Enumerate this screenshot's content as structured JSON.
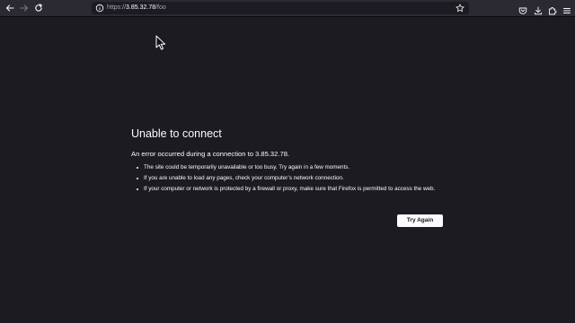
{
  "browser": {
    "url_scheme": "https://",
    "url_host": "3.85.32.78",
    "url_path": "/foo"
  },
  "icons": {
    "back": "back-arrow-icon",
    "forward": "forward-arrow-icon",
    "reload": "reload-icon",
    "site_info": "info-icon",
    "bookmark": "star-icon",
    "pocket": "pocket-icon",
    "downloads": "download-icon",
    "extensions": "puzzle-icon",
    "menu": "hamburger-menu-icon"
  },
  "error_page": {
    "title": "Unable to connect",
    "description": "An error occurred during a connection to 3.85.32.78.",
    "tips": [
      "The site could be temporarily unavailable or too busy. Try again in a few moments.",
      "If you are unable to load any pages, check your computer’s network connection.",
      "If your computer or network is protected by a firewall or proxy, make sure that Firefox is permitted to access the web."
    ],
    "try_again_label": "Try Again"
  },
  "colors": {
    "page_background": "#1c1b22",
    "toolbar_background": "#2b2a33",
    "text": "#fbfbfe",
    "button_background": "#fbfbfe",
    "button_text": "#15141a"
  }
}
